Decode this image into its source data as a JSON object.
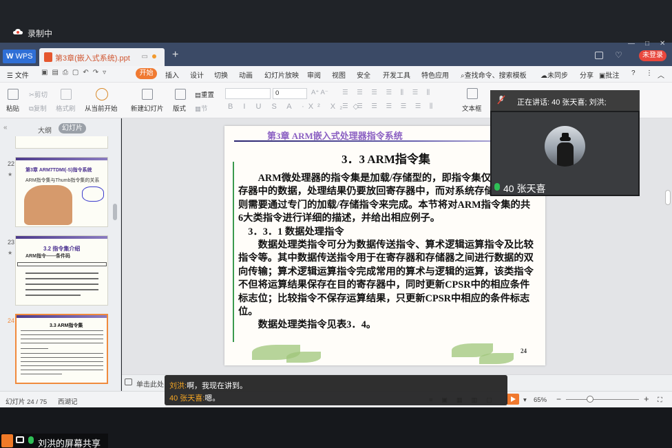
{
  "recording": {
    "label": "录制中"
  },
  "wps": {
    "app_tab": "WPS",
    "doc_tab": "第3章(嵌入式系统).ppt",
    "login": "未登录"
  },
  "menu": {
    "file": "文件",
    "items": [
      "开始",
      "插入",
      "设计",
      "切换",
      "动画",
      "幻灯片放映",
      "审阅",
      "视图",
      "安全",
      "开发工具",
      "特色应用"
    ],
    "search": "查找命令、搜索模板",
    "sync": "未同步",
    "share": "分享",
    "comment": "批注",
    "help": "?"
  },
  "ribbon": {
    "paste": "粘贴",
    "cut": "剪切",
    "copy": "复制",
    "format_painter": "格式刷",
    "from_start": "从当前开始",
    "new_slide": "新建幻灯片",
    "layout": "版式",
    "reset": "重置",
    "section": "节",
    "font_size": "0",
    "textbox": "文本框"
  },
  "left_panel": {
    "outline_tab": "大纲",
    "slides_tab": "幻灯片",
    "thumbs": [
      {
        "num": "22",
        "title": "第3章 ARM7TDMI(-S)指令系统",
        "sub": "ARM指令集与Thumb指令集的关系"
      },
      {
        "num": "23",
        "title": "3.2 指令集介绍",
        "sub": "ARM指令——条件码"
      },
      {
        "num": "24",
        "title": "3.3 ARM指令集",
        "sub": ""
      }
    ]
  },
  "slide": {
    "chapter": "第3章 ARM嵌入式处理器指令系统",
    "heading": "3．3  ARM指令集",
    "paragraphs": [
      "ARM微处理器的指令集是加载/存储型的，即指令集仅能处理寄存器中的数据，处理结果仍要放回寄存器中，而对系统存储器的访问则需要通过专门的加载/存储指令来完成。本节将对ARM指令集的共6大类指令进行详细的描述，并给出相应例子。",
      "3．3．1  数据处理指令",
      "数据处理类指令可分为数据传送指令、算术逻辑运算指令及比较指令等。其中数据传送指令用于在寄存器和存储器之间进行数据的双向传输；算术逻辑运算指令完成常用的算术与逻辑的运算，该类指令不但将运算结果保存在目的寄存器中，同时更新CPSR中的相应条件标志位；比较指令不保存运算结果，只更新CPSR中相应的条件标志位。",
      "数据处理类指令见表3．4。"
    ],
    "page_no": "24"
  },
  "notes": {
    "placeholder": "单击此处"
  },
  "status": {
    "slide_counter": "幻灯片 24 / 75",
    "theme": "西湖记",
    "zoom": "65%"
  },
  "chat": [
    {
      "name": "刘洪:",
      "text": "啊，我现在讲到。"
    },
    {
      "name": "40 张天喜:",
      "text": "嗯。"
    }
  ],
  "video": {
    "speaking": "正在讲话: 40 张天喜; 刘洪;",
    "name": "40 张天喜"
  },
  "screen_share": {
    "label": "刘洪的屏幕共享"
  }
}
